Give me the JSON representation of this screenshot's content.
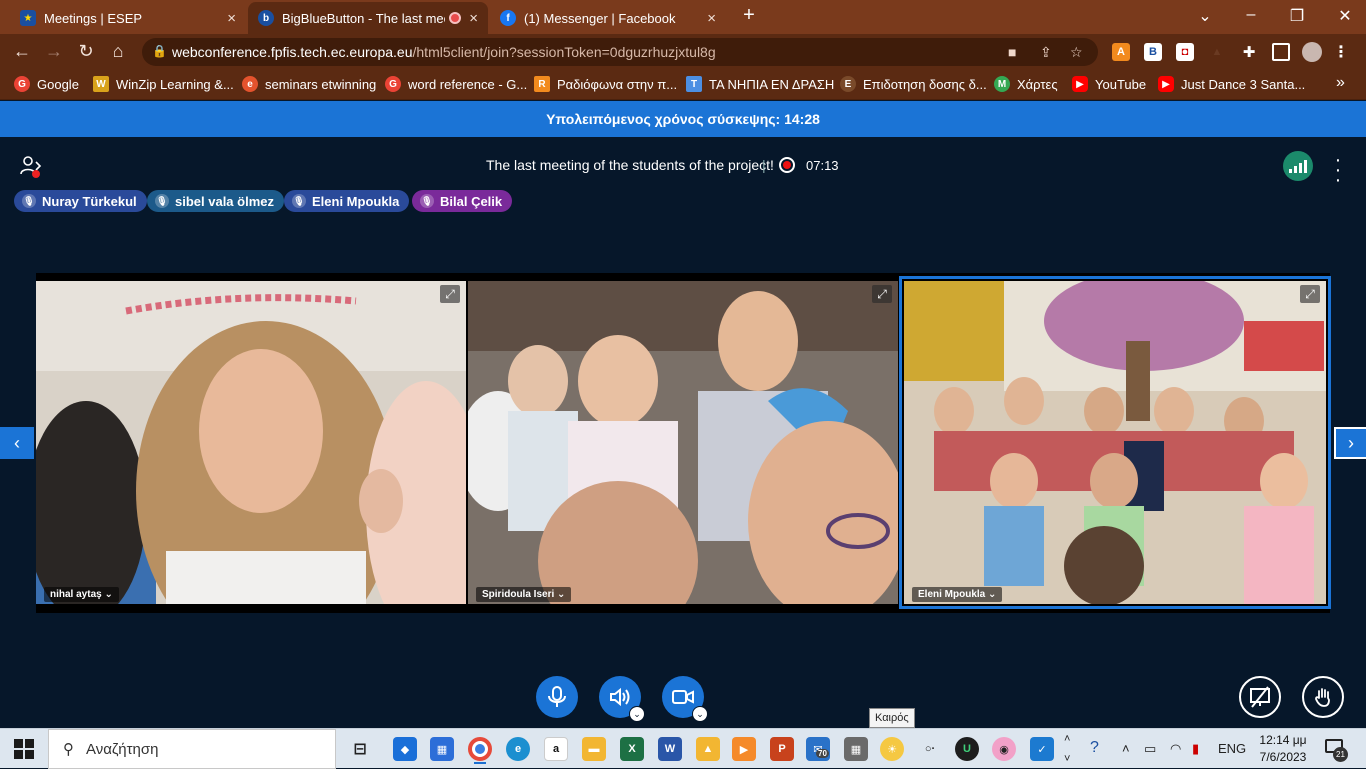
{
  "browser": {
    "tabs": [
      {
        "title": "Meetings | ESEP",
        "favicon_color": "#1a4fa0",
        "active": false
      },
      {
        "title": "BigBlueButton - The last mee",
        "favicon_color": "#1a4fa0",
        "active": true
      },
      {
        "title": "(1) Messenger | Facebook",
        "favicon_color": "#1877f2",
        "active": false
      }
    ],
    "new_tab_label": "+",
    "close_label": "×",
    "url_host": "webconference.fpfis.tech.ec.europa.eu",
    "url_path": "/html5client/join?sessionToken=0dguzrhuzjxtul8g",
    "bookmarks": [
      {
        "label": "Google",
        "color": "#ea4335",
        "glyph": "G"
      },
      {
        "label": "WinZip Learning &...",
        "color": "#d9a21b",
        "glyph": "W"
      },
      {
        "label": "seminars etwinning",
        "color": "#e4532d",
        "glyph": "e"
      },
      {
        "label": "word reference - G...",
        "color": "#ea4335",
        "glyph": "G"
      },
      {
        "label": "Ραδιόφωνα στην π...",
        "color": "#f28a1e",
        "glyph": "R"
      },
      {
        "label": "ΤΑ ΝΗΠΙΑ ΕΝ ΔΡΑΣΗ",
        "color": "#4c8fe3",
        "glyph": "T"
      },
      {
        "label": "Επιδοτηση δοσης δ...",
        "color": "#7a4a2a",
        "glyph": "E"
      },
      {
        "label": "Χάρτες",
        "color": "#34a853",
        "glyph": "M"
      },
      {
        "label": "YouTube",
        "color": "#ff0000",
        "glyph": "▶"
      },
      {
        "label": "Just Dance 3 Santa...",
        "color": "#ff0000",
        "glyph": "▶"
      }
    ],
    "more_bookmarks": "»"
  },
  "conference": {
    "remaining_time": "Υπολειπόμενος χρόνος σύσκεψης: 14:28",
    "meeting_title": "The last meeting of the students of the project!",
    "separator": "|",
    "recording_time": "07:13",
    "talkers": [
      {
        "name": "Nuray Türkekul",
        "color": "#2a4a9a"
      },
      {
        "name": "sibel vala ölmez",
        "color": "#1c5a8a"
      },
      {
        "name": "Eleni Mpoukla",
        "color": "#2a4a9a"
      },
      {
        "name": "Bilal Çelik",
        "color": "#7a2a9a"
      }
    ],
    "videos": [
      {
        "name": "nihal aytaş",
        "speaking": false
      },
      {
        "name": "Spiridoula Iseri",
        "speaking": false
      },
      {
        "name": "Eleni Mpoukla",
        "speaking": true
      }
    ],
    "accent_color": "#1b74d6"
  },
  "taskbar": {
    "search_placeholder": "Αναζήτηση",
    "tooltip": "Καιρός",
    "language": "ENG",
    "time": "12:14 μμ",
    "date": "7/6/2023",
    "notifications": "21",
    "mail_badge": "70"
  }
}
